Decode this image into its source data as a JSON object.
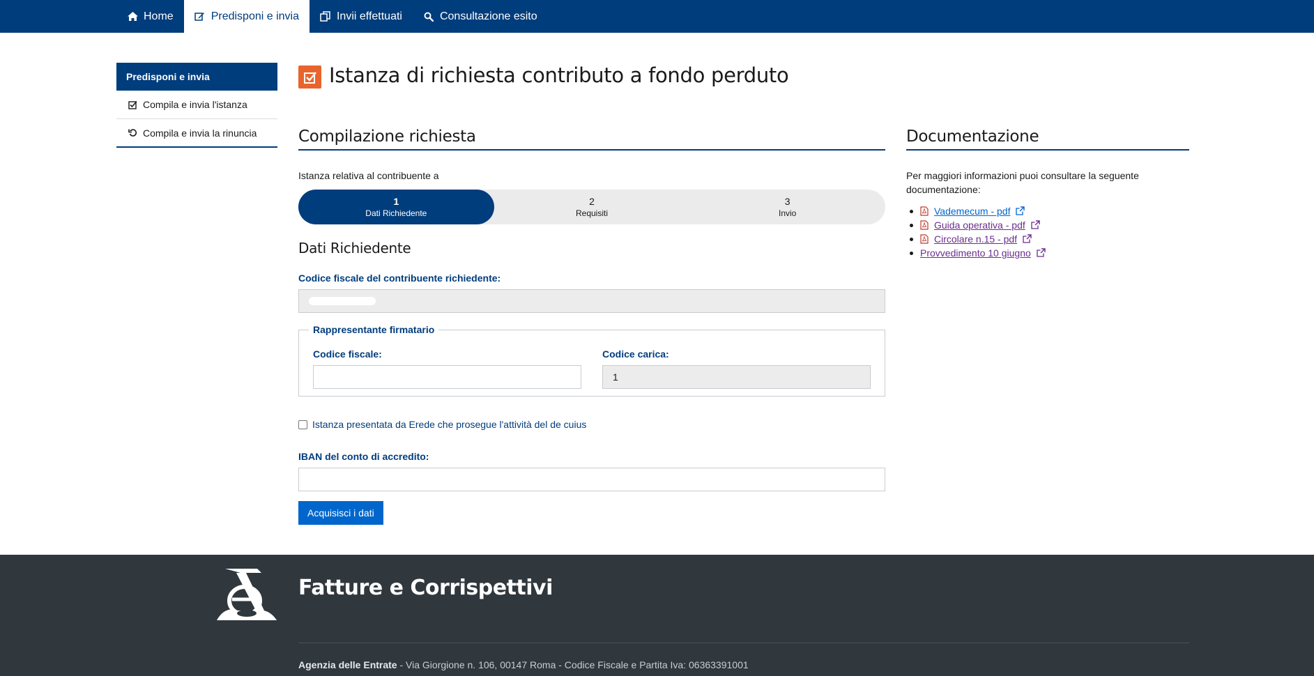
{
  "nav": {
    "items": [
      {
        "label": "Home",
        "icon": "home-icon"
      },
      {
        "label": "Predisponi e invia",
        "icon": "edit-icon",
        "active": true
      },
      {
        "label": "Invii effettuati",
        "icon": "copy-icon"
      },
      {
        "label": "Consultazione esito",
        "icon": "search-icon"
      }
    ]
  },
  "sidebar": {
    "title": "Predisponi e invia",
    "items": [
      {
        "label": "Compila e invia l'istanza",
        "icon": "check-square-icon"
      },
      {
        "label": "Compila e invia la rinuncia",
        "icon": "undo-icon"
      }
    ]
  },
  "page": {
    "title": "Istanza di richiesta contributo a fondo perduto",
    "icon": "check-square-icon",
    "icon_color": "#e8642c"
  },
  "form": {
    "section_title": "Compilazione richiesta",
    "intro": "Istanza relativa al contribuente a",
    "steps": [
      {
        "num": "1",
        "label": "Dati Richiedente",
        "active": true
      },
      {
        "num": "2",
        "label": "Requisiti"
      },
      {
        "num": "3",
        "label": "Invio"
      }
    ],
    "subsection_title": "Dati Richiedente",
    "cf_label": "Codice fiscale del contribuente richiedente:",
    "rappresentante": {
      "legend": "Rappresentante firmatario",
      "cf_label": "Codice fiscale:",
      "cf_value": "",
      "carica_label": "Codice carica:",
      "carica_value": "1"
    },
    "erede_checkbox_label": "Istanza presentata da Erede che prosegue l'attività del de cuius",
    "iban_label": "IBAN del conto di accredito:",
    "iban_value": "",
    "submit_label": "Acquisisci i dati"
  },
  "docs": {
    "title": "Documentazione",
    "intro": "Per maggiori informazioni puoi consultare la seguente documentazione:",
    "links": [
      {
        "label": "Vademecum - pdf ",
        "pdf": true
      },
      {
        "label": "Guida operativa - pdf",
        "pdf": true
      },
      {
        "label": "Circolare n.15 - pdf",
        "pdf": true
      },
      {
        "label": "Provvedimento 10 giugno",
        "pdf": false
      }
    ]
  },
  "footer": {
    "brand": "Fatture e Corrispettivi",
    "org": "Agenzia delle Entrate",
    "address": " - Via Giorgione n. 106, 00147 Roma - Codice Fiscale e Partita Iva: 06363391001"
  },
  "colors": {
    "primary": "#003d7c",
    "accent": "#e8642c",
    "button": "#0066cc",
    "footer": "#30373d",
    "visited_link": "#6a2d8f"
  }
}
